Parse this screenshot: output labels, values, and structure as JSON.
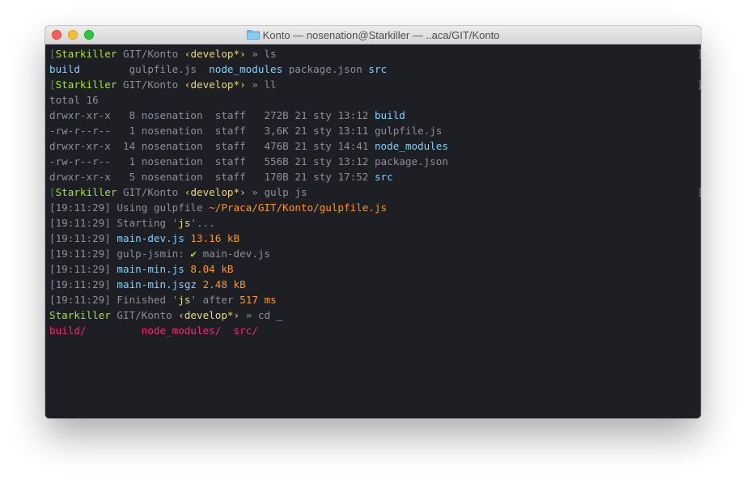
{
  "window": {
    "title": "Konto — nosenation@Starkiller — ..aca/GIT/Konto"
  },
  "prompt": {
    "host": "Starkiller",
    "path": "GIT/Konto",
    "branch": "‹develop*›",
    "arrow": "»"
  },
  "commands": {
    "ls": "ls",
    "ll": "ll",
    "gulp": "gulp js",
    "cd": "cd"
  },
  "ls_output": [
    "build",
    "gulpfile.js",
    "node_modules",
    "package.json",
    "src"
  ],
  "ll_total": "total 16",
  "ll_rows": [
    {
      "perms": "drwxr-xr-x",
      "links": "8",
      "owner": "nosenation",
      "group": "staff",
      "size": "272B",
      "date": "21 sty 13:12",
      "name": "build",
      "is_dir": true
    },
    {
      "perms": "-rw-r--r--",
      "links": "1",
      "owner": "nosenation",
      "group": "staff",
      "size": "3,6K",
      "date": "21 sty 13:11",
      "name": "gulpfile.js",
      "is_dir": false
    },
    {
      "perms": "drwxr-xr-x",
      "links": "14",
      "owner": "nosenation",
      "group": "staff",
      "size": "476B",
      "date": "21 sty 14:41",
      "name": "node_modules",
      "is_dir": true
    },
    {
      "perms": "-rw-r--r--",
      "links": "1",
      "owner": "nosenation",
      "group": "staff",
      "size": "556B",
      "date": "21 sty 13:12",
      "name": "package.json",
      "is_dir": false
    },
    {
      "perms": "drwxr-xr-x",
      "links": "5",
      "owner": "nosenation",
      "group": "staff",
      "size": "170B",
      "date": "21 sty 17:52",
      "name": "src",
      "is_dir": true
    }
  ],
  "gulp": {
    "time": "[19:11:29]",
    "using": "Using gulpfile",
    "gulpfile_path": "~/Praca/GIT/Konto/gulpfile.js",
    "starting": "Starting",
    "task": "js",
    "ellipsis": "...",
    "main_dev": "main-dev.js",
    "main_dev_size": "13.16 kB",
    "jsmin": "gulp-jsmin:",
    "check": "✔",
    "jsmin_file": "main-dev.js",
    "main_min": "main-min.js",
    "main_min_size": "8.04 kB",
    "main_min_gz": "main-min.jsgz",
    "main_min_gz_size": "2.48 kB",
    "finished": "Finished",
    "after": "after",
    "duration": "517 ms"
  },
  "completions": [
    "build/",
    "node_modules/",
    "src/"
  ],
  "cursor": "_"
}
